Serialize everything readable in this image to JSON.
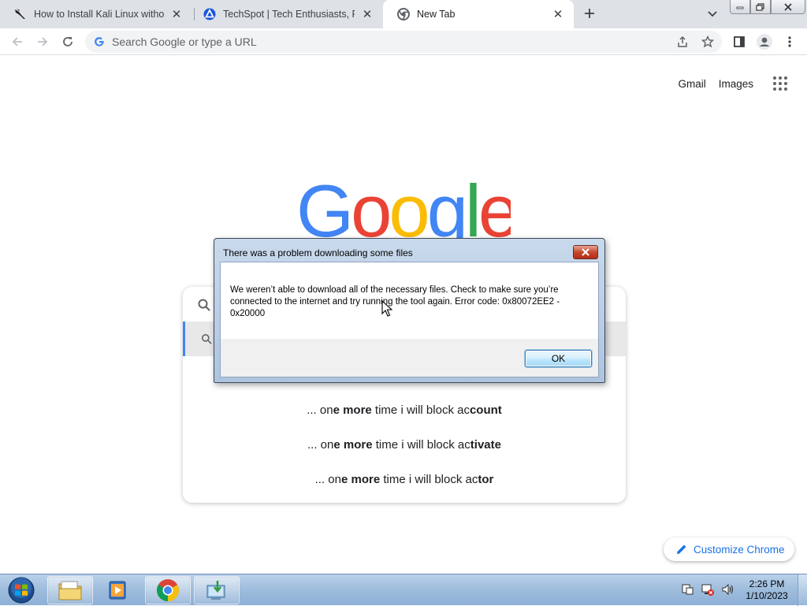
{
  "tabs": [
    {
      "title": "How to Install Kali Linux without",
      "icon": "kali-dragon-icon",
      "active": false
    },
    {
      "title": "TechSpot | Tech Enthusiasts, Pow",
      "icon": "techspot-icon",
      "active": false
    },
    {
      "title": "New Tab",
      "icon": "chrome-icon",
      "active": true
    }
  ],
  "toolbar": {
    "omnibox_placeholder": "Search Google or type a URL"
  },
  "page": {
    "gmail_link": "Gmail",
    "images_link": "Images",
    "logo_letters": [
      {
        "char": "G",
        "color": "#4285f4"
      },
      {
        "char": "o",
        "color": "#ea4335"
      },
      {
        "char": "o",
        "color": "#fbbc05"
      },
      {
        "char": "g",
        "color": "#4285f4"
      },
      {
        "char": "l",
        "color": "#34a853"
      },
      {
        "char": "e",
        "color": "#ea4335"
      }
    ],
    "suggestions": [
      {
        "prefix": "... on",
        "bold1": "e more",
        "mid": " time i will block ac",
        "bold2": "count"
      },
      {
        "prefix": "... on",
        "bold1": "e more",
        "mid": " time i will block ac",
        "bold2": "tivate"
      },
      {
        "prefix": "... on",
        "bold1": "e more",
        "mid": " time i will block ac",
        "bold2": "tor"
      }
    ],
    "customize_label": "Customize Chrome"
  },
  "dialog": {
    "title": "There was a problem downloading some files",
    "message": "We weren’t able to download all of the necessary files. Check to make sure you’re connected to the internet and try running the tool again. Error code: 0x80072EE2 - 0x20000",
    "ok_label": "OK"
  },
  "taskbar": {
    "time": "2:26 PM",
    "date": "1/10/2023"
  },
  "colors": {
    "accent": "#1a73e8",
    "tabstrip": "#dee1e6"
  }
}
